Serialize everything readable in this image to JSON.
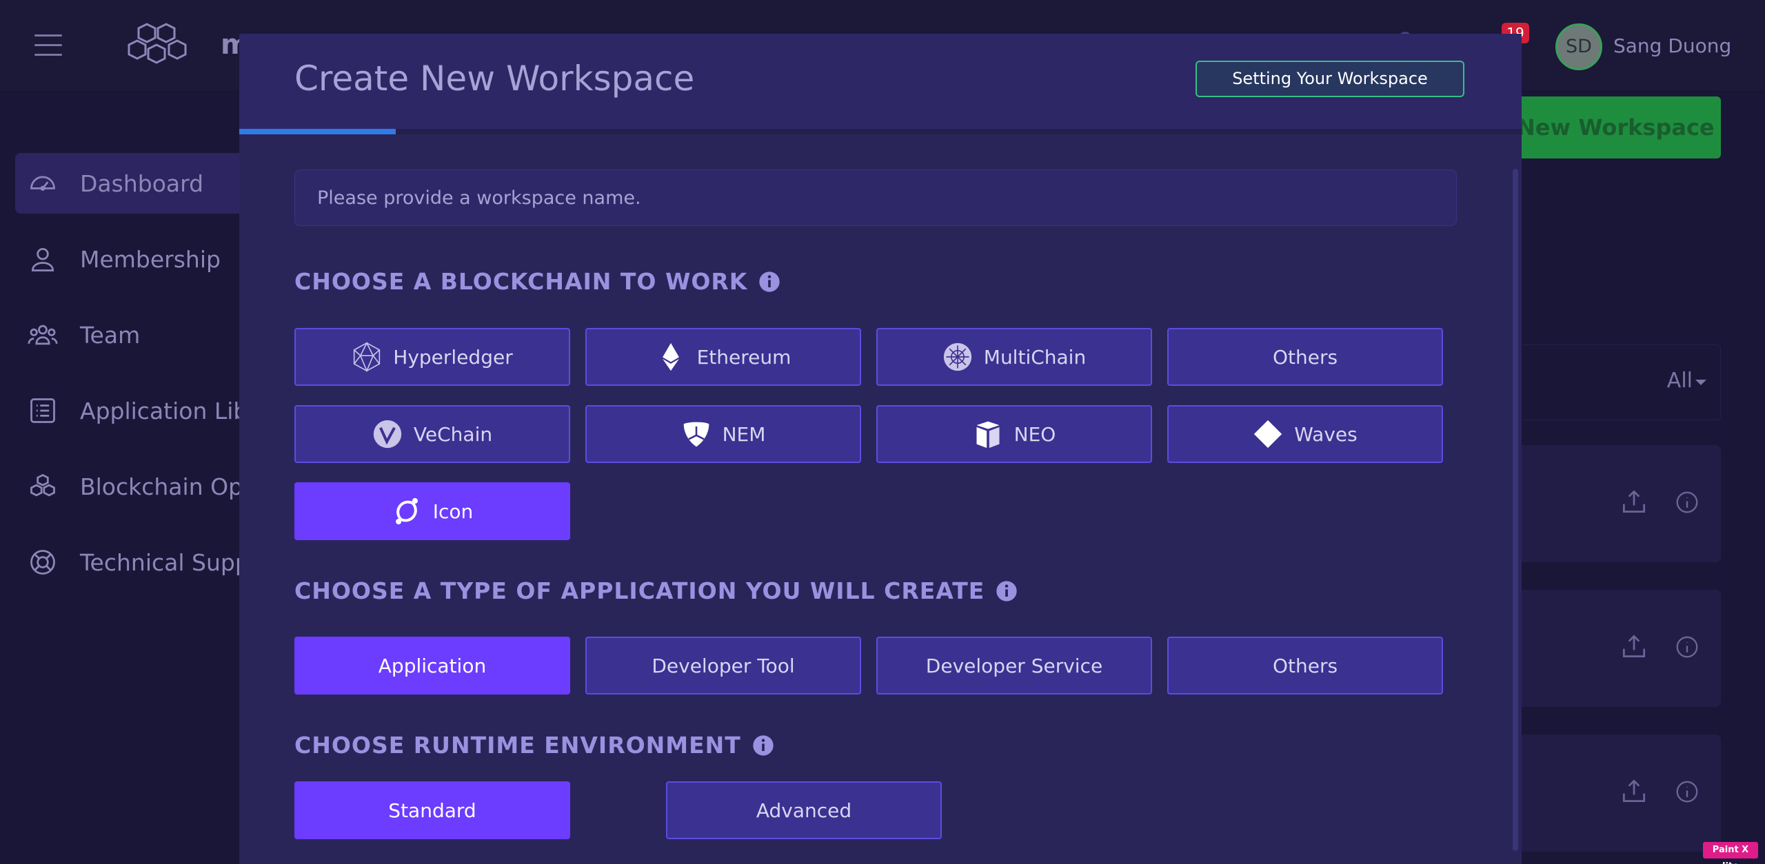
{
  "topbar": {
    "logo_text": "m",
    "notification_count": "19",
    "avatar_initials": "SD",
    "user_name": "Sang Duong"
  },
  "sidebar": {
    "items": [
      {
        "label": "Dashboard",
        "icon": "speedometer-icon",
        "active": true
      },
      {
        "label": "Membership",
        "icon": "user-icon"
      },
      {
        "label": "Team",
        "icon": "users-icon"
      },
      {
        "label": "Application Library",
        "icon": "list-icon"
      },
      {
        "label": "Blockchain Ops",
        "icon": "cubes-icon"
      },
      {
        "label": "Technical Support",
        "icon": "lifebuoy-icon"
      }
    ]
  },
  "background": {
    "new_workspace_label": "New Workspace",
    "filter_label": "All"
  },
  "modal": {
    "title": "Create New Workspace",
    "header_badge": "Setting Your Workspace",
    "progress_fraction": 0.122,
    "name_placeholder": "Please provide a workspace name.",
    "blockchain_section": {
      "title": "CHOOSE A BLOCKCHAIN TO WORK",
      "options": [
        {
          "label": "Hyperledger",
          "icon": "hyperledger-icon"
        },
        {
          "label": "Ethereum",
          "icon": "ethereum-icon"
        },
        {
          "label": "MultiChain",
          "icon": "multichain-icon"
        },
        {
          "label": "Others"
        },
        {
          "label": "VeChain",
          "icon": "vechain-icon"
        },
        {
          "label": "NEM",
          "icon": "nem-icon"
        },
        {
          "label": "NEO",
          "icon": "neo-icon"
        },
        {
          "label": "Waves",
          "icon": "waves-icon"
        },
        {
          "label": "Icon",
          "icon": "icon-network-icon",
          "selected": true
        }
      ]
    },
    "app_type_section": {
      "title": "CHOOSE A TYPE OF APPLICATION YOU WILL CREATE",
      "options": [
        {
          "label": "Application",
          "selected": true
        },
        {
          "label": "Developer Tool"
        },
        {
          "label": "Developer Service"
        },
        {
          "label": "Others"
        }
      ]
    },
    "runtime_section": {
      "title": "CHOOSE RUNTIME ENVIRONMENT",
      "options": [
        {
          "label": "Standard",
          "selected": true
        },
        {
          "label": "Advanced"
        }
      ]
    }
  },
  "paint_badge": "Paint X lite",
  "colors": {
    "page_bg": "#1a1638",
    "modal_bg": "#2a2559",
    "option_bg": "#3b3191",
    "selected": "#6c3cff",
    "progress": "#2f7be8",
    "accent_green": "#35c085"
  }
}
